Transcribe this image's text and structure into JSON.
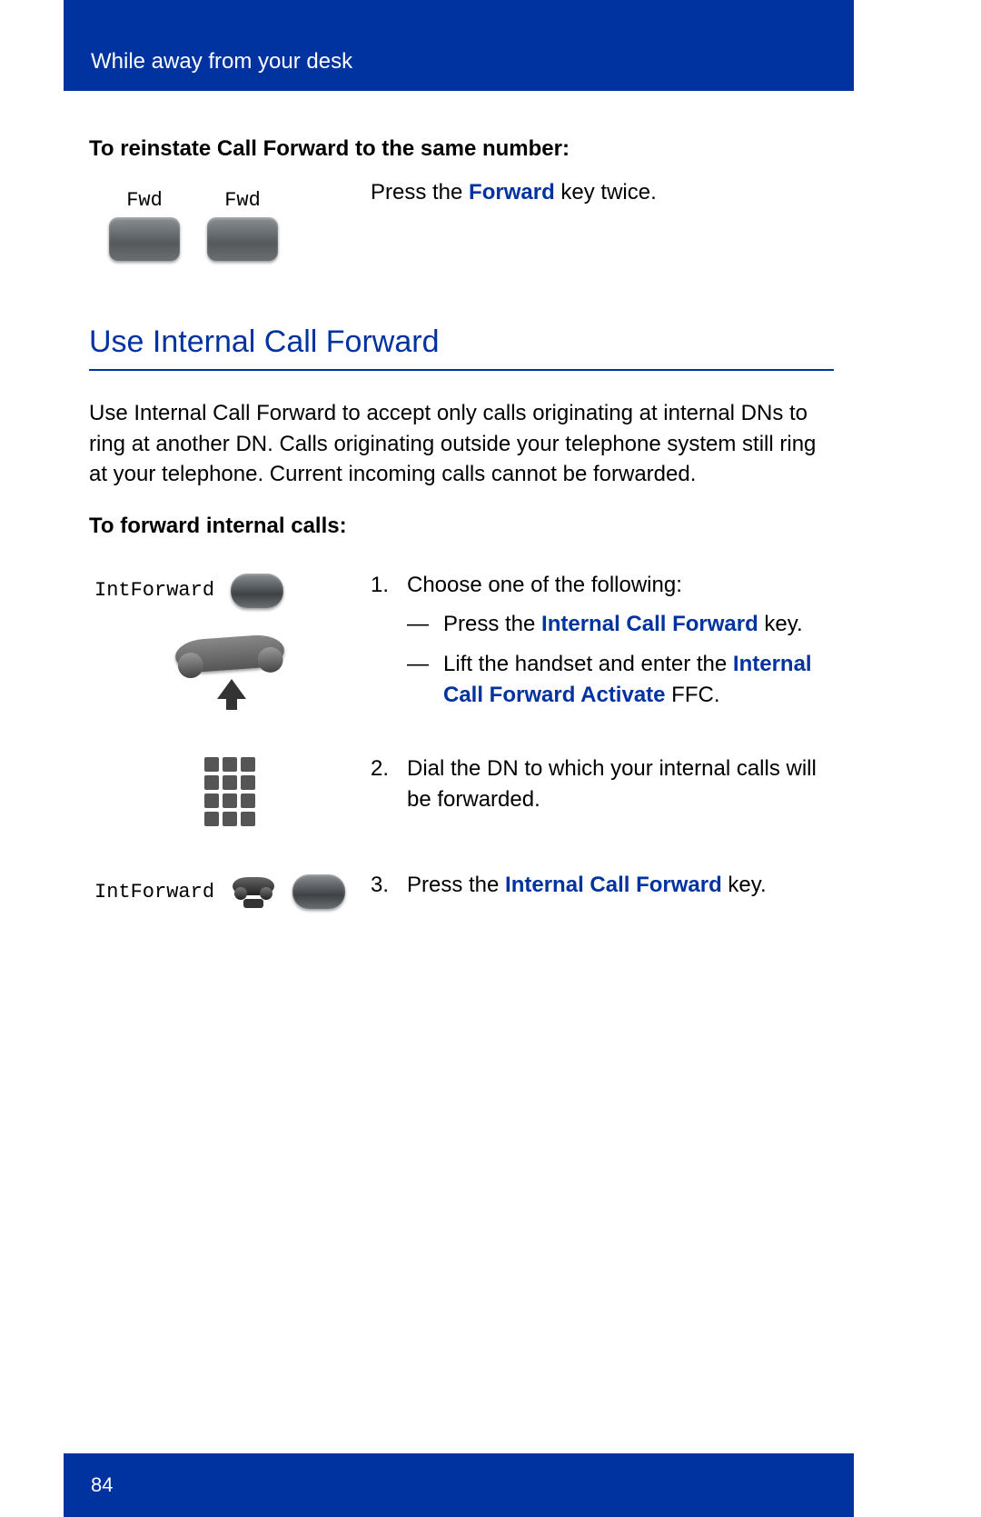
{
  "header": {
    "title": "While away from your desk"
  },
  "reinstate": {
    "heading": "To reinstate Call Forward to the same number:",
    "instruction_pre": "Press the ",
    "instruction_key": "Forward",
    "instruction_post": " key twice.",
    "key_label": "Fwd"
  },
  "section": {
    "title": "Use Internal Call Forward",
    "body": "Use Internal Call Forward to accept only calls originating at internal DNs to ring at another DN. Calls originating outside your telephone system still ring at your telephone. Current incoming calls cannot be forwarded."
  },
  "forward_internal": {
    "heading": "To forward internal calls:",
    "int_label": "IntForward",
    "step1": {
      "lead": "Choose one of the following:",
      "a_pre": "Press the ",
      "a_key": "Internal Call Forward",
      "a_post": " key.",
      "b_pre": "Lift the handset and enter the ",
      "b_key": "Internal Call Forward Activate",
      "b_post": " FFC."
    },
    "step2": "Dial the DN to which your internal calls will be forwarded.",
    "step3_pre": "Press the ",
    "step3_key": "Internal Call Forward",
    "step3_post": " key."
  },
  "footer": {
    "page": "84"
  }
}
